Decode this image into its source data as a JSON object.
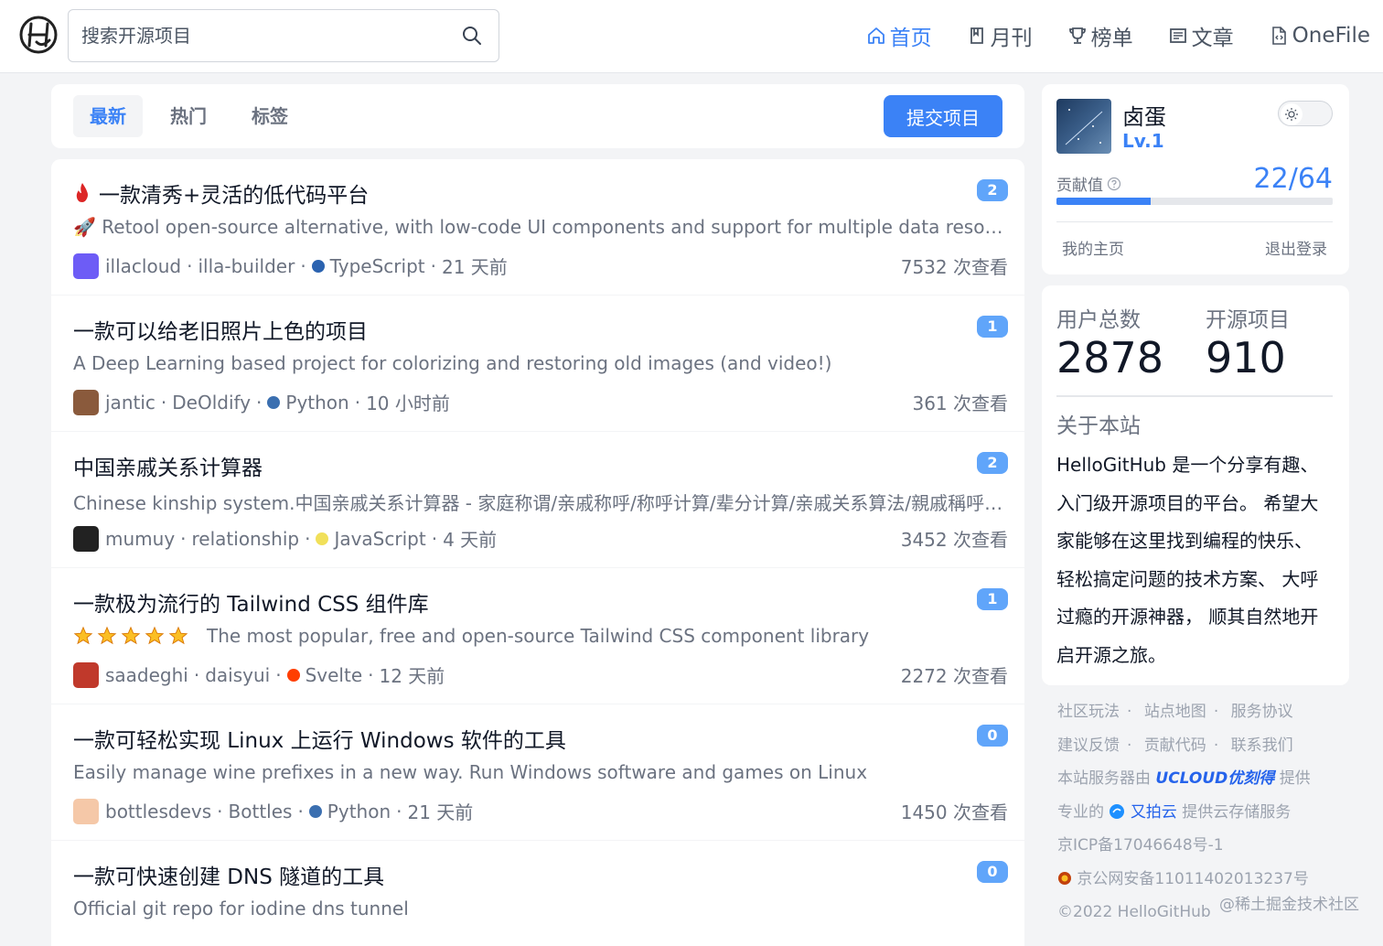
{
  "header": {
    "search_placeholder": "搜索开源项目",
    "nav": [
      {
        "label": "首页",
        "icon": "home-icon",
        "active": true
      },
      {
        "label": "月刊",
        "icon": "book-icon"
      },
      {
        "label": "榜单",
        "icon": "trophy-icon"
      },
      {
        "label": "文章",
        "icon": "article-icon"
      },
      {
        "label": "OneFile",
        "icon": "file-code-icon"
      }
    ]
  },
  "tabs": [
    "最新",
    "热门",
    "标签"
  ],
  "submit_label": "提交项目",
  "items": [
    {
      "title": "一款清秀+灵活的低代码平台",
      "hot": true,
      "badge": "2",
      "desc": "🚀 Retool open-source alternative, with low-code UI components and support for multiple data resources.",
      "author": "illacloud",
      "repo": "illa-builder",
      "lang": "TypeScript",
      "lang_color": "#2b63b0",
      "time": "21 天前",
      "views": "7532 次查看",
      "avatar_color": "#6d5cf6"
    },
    {
      "title": "一款可以给老旧照片上色的项目",
      "badge": "1",
      "desc": "A Deep Learning based project for colorizing and restoring old images (and video!)",
      "author": "jantic",
      "repo": "DeOldify",
      "lang": "Python",
      "lang_color": "#3b6fb0",
      "time": "10 小时前",
      "views": "361 次查看",
      "avatar_color": "#8a5a3c"
    },
    {
      "title": "中国亲戚关系计算器",
      "badge": "2",
      "desc": "Chinese kinship system.中国亲戚关系计算器 - 家庭称谓/亲戚称呼/称呼计算/辈分计算/亲戚关系算法/親戚稱呼計算器",
      "author": "mumuy",
      "repo": "relationship",
      "lang": "JavaScript",
      "lang_color": "#f1e05a",
      "time": "4 天前",
      "views": "3452 次查看",
      "avatar_color": "#222222"
    },
    {
      "title": "一款极为流行的 Tailwind CSS 组件库",
      "badge": "1",
      "stars": 5,
      "desc": "The most popular, free and open-source Tailwind CSS component library",
      "author": "saadeghi",
      "repo": "daisyui",
      "lang": "Svelte",
      "lang_color": "#ff3e00",
      "time": "12 天前",
      "views": "2272 次查看",
      "avatar_color": "#c0392b"
    },
    {
      "title": "一款可轻松实现 Linux 上运行 Windows 软件的工具",
      "badge": "0",
      "desc": "Easily manage wine prefixes in a new way. Run Windows software and games on Linux",
      "author": "bottlesdevs",
      "repo": "Bottles",
      "lang": "Python",
      "lang_color": "#3b6fb0",
      "time": "21 天前",
      "views": "1450 次查看",
      "avatar_color": "#f5c8a8"
    },
    {
      "title": "一款可快速创建 DNS 隧道的工具",
      "badge": "0",
      "desc": "Official git repo for iodine dns tunnel",
      "author": "",
      "repo": "",
      "lang": "",
      "lang_color": "#3b6fb0",
      "time": "",
      "views": "",
      "avatar_color": "#cccccc"
    }
  ],
  "user": {
    "name": "卤蛋",
    "level": "Lv.1",
    "contrib_label": "贡献值",
    "contrib_value": "22/64",
    "contrib_fraction": 0.34,
    "home_link": "我的主页",
    "logout_link": "退出登录"
  },
  "stats": {
    "users_label": "用户总数",
    "users_value": "2878",
    "projects_label": "开源项目",
    "projects_value": "910",
    "about_title": "关于本站",
    "about_text": "HelloGitHub 是一个分享有趣、入门级开源项目的平台。 希望大家能够在这里找到编程的快乐、 轻松搞定问题的技术方案、 大呼过瘾的开源神器， 顺其自然地开启开源之旅。"
  },
  "footer": {
    "links1": [
      "社区玩法",
      "站点地图",
      "服务协议"
    ],
    "links2": [
      "建议反馈",
      "贡献代码",
      "联系我们"
    ],
    "server_prefix": "本站服务器由",
    "server_brand": "UCLOUD优刻得",
    "server_suffix": "提供",
    "storage_prefix": "专业的",
    "storage_brand": "又拍云",
    "storage_suffix": "提供云存储服务",
    "icp": "京ICP备17046648号-1",
    "police": "京公网安备11011402013237号",
    "copyright": "©2022 HelloGitHub",
    "watermark": "@稀土掘金技术社区"
  }
}
